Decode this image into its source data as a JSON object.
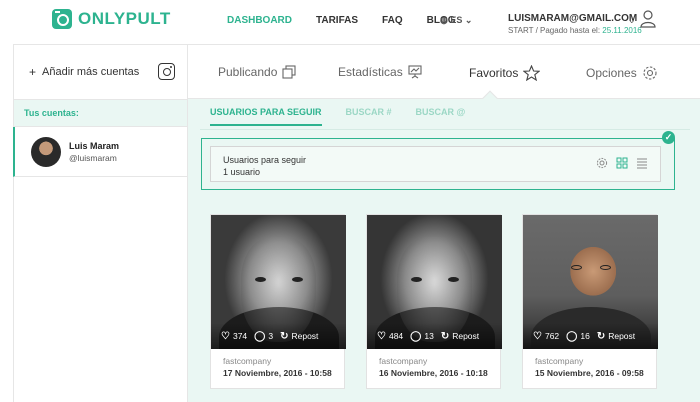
{
  "brand": {
    "name": "ONLYPULT",
    "accent": "#2db38f"
  },
  "topnav": {
    "items": [
      {
        "label": "DASHBOARD",
        "active": true
      },
      {
        "label": "TARIFAS",
        "active": false
      },
      {
        "label": "FAQ",
        "active": false
      },
      {
        "label": "BLOG",
        "active": false
      }
    ],
    "language": "ES"
  },
  "user": {
    "email": "LUISMARAM@GMAIL.COM",
    "plan_prefix": "START / Pagado hasta el:",
    "paid_until": "25.11.2016"
  },
  "sidebar": {
    "add_accounts_label": "Añadir más cuentas",
    "your_accounts_label": "Tus cuentas:",
    "accounts": [
      {
        "name": "Luis Maram",
        "handle": "@luismaram"
      }
    ]
  },
  "main_tabs": [
    {
      "label": "Publicando",
      "icon": "copy-icon"
    },
    {
      "label": "Estadísticas",
      "icon": "presentation-icon"
    },
    {
      "label": "Favoritos",
      "icon": "star-icon",
      "active": true
    },
    {
      "label": "Opciones",
      "icon": "gear-icon"
    }
  ],
  "sub_tabs": [
    {
      "label": "USUARIOS PARA SEGUIR",
      "active": true
    },
    {
      "label": "BUSCAR #",
      "active": false
    },
    {
      "label": "BUSCAR @",
      "active": false
    }
  ],
  "follow_box": {
    "title": "Usuarios para seguir",
    "count": "1 usuario"
  },
  "posts": [
    {
      "likes": "374",
      "comments": "3",
      "repost_label": "Repost",
      "source": "fastcompany",
      "date": "17 Noviembre, 2016 - 10:58"
    },
    {
      "likes": "484",
      "comments": "13",
      "repost_label": "Repost",
      "source": "fastcompany",
      "date": "16 Noviembre, 2016 - 10:18"
    },
    {
      "likes": "762",
      "comments": "16",
      "repost_label": "Repost",
      "source": "fastcompany",
      "date": "15 Noviembre, 2016 - 09:58"
    }
  ]
}
